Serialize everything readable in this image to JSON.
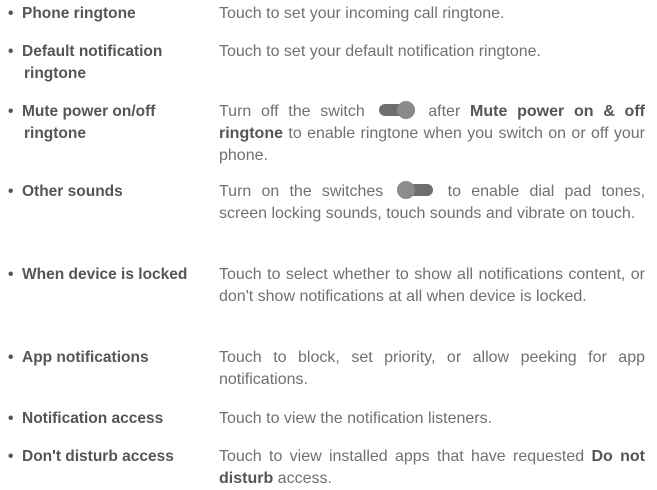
{
  "items": [
    {
      "term": "Phone ringtone",
      "desc": "Touch to set your incoming call ringtone."
    },
    {
      "term_line1": "Default notification",
      "term_line2": "ringtone",
      "desc": "Touch to set your default notification ringtone."
    },
    {
      "term_line1": "Mute power on/off",
      "term_line2": "ringtone",
      "desc_before": "Turn off the switch",
      "desc_bold": "Mute power on & off ringtone",
      "desc_pre_bold": "after",
      "desc_after": "to enable ringtone when you switch on or off your phone.",
      "toggle_icon": "toggle-on-icon"
    },
    {
      "term": "Other sounds",
      "desc_before": "Turn on the switches",
      "desc_after": "to enable dial pad tones, screen locking sounds, touch sounds and vibrate on touch.",
      "toggle_icon": "toggle-off-icon"
    },
    {
      "term": "When device is locked",
      "desc": "Touch to select whether to show all notifications content, or don't show notifications at all when device is locked."
    },
    {
      "term": "App notifications",
      "desc": "Touch to block, set priority, or allow peeking for app notifications."
    },
    {
      "term": "Notification access",
      "desc": "Touch to view the notification listeners."
    },
    {
      "term": "Don't disturb access",
      "desc_before": "Touch to view installed apps that have requested",
      "desc_bold": "Do not disturb",
      "desc_after": "access."
    }
  ],
  "bullet": "•"
}
